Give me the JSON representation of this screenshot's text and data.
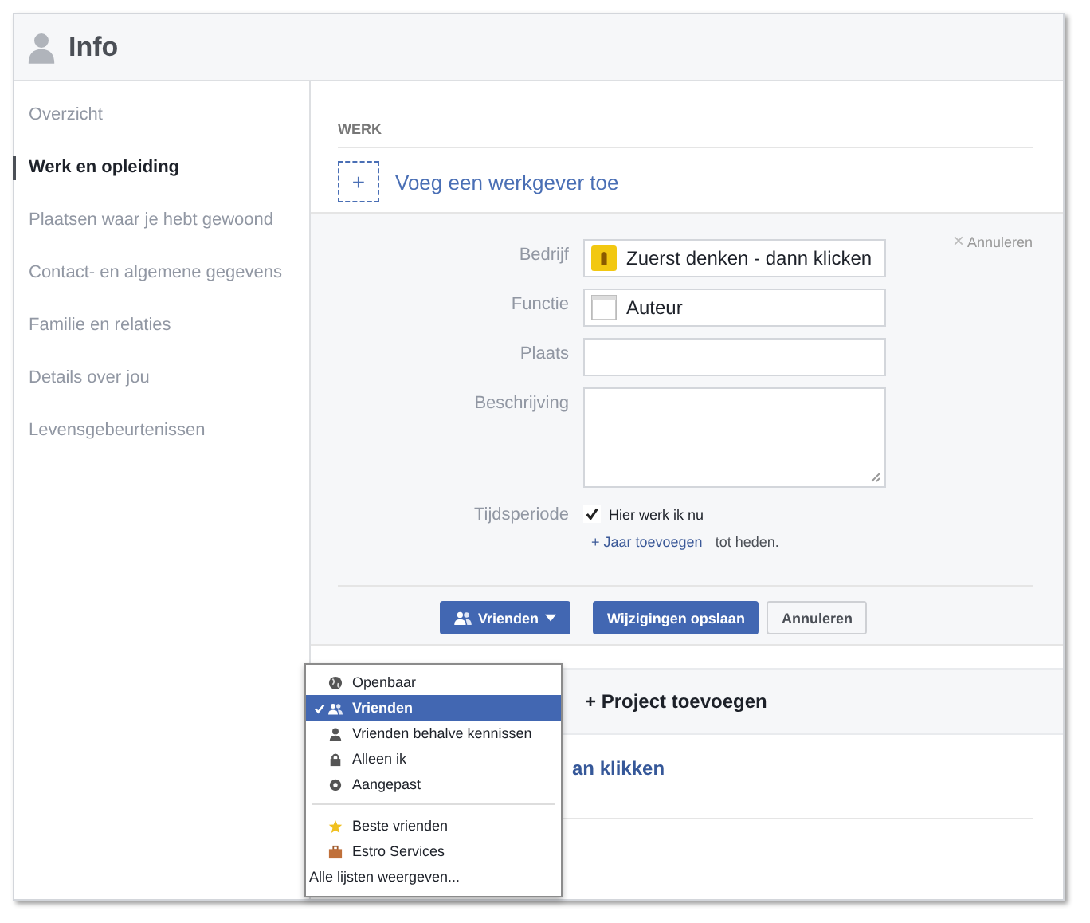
{
  "header": {
    "title": "Info"
  },
  "sidebar": {
    "items": [
      {
        "label": "Overzicht",
        "selected": false
      },
      {
        "label": "Werk en opleiding",
        "selected": true
      },
      {
        "label": "Plaatsen waar je hebt gewoond",
        "selected": false
      },
      {
        "label": "Contact- en algemene gegevens",
        "selected": false
      },
      {
        "label": "Familie en relaties",
        "selected": false
      },
      {
        "label": "Details over jou",
        "selected": false
      },
      {
        "label": "Levensgebeurtenissen",
        "selected": false
      }
    ]
  },
  "section": {
    "heading": "WERK",
    "add_link": "Voeg een werkgever toe",
    "add_symbol": "+"
  },
  "form": {
    "cancel_link": "Annuleren",
    "cancel_symbol": "×",
    "fields": [
      {
        "label": "Bedrijf",
        "kind": "company",
        "value": "Zuerst denken - dann klicken"
      },
      {
        "label": "Functie",
        "kind": "position",
        "value": "Auteur"
      },
      {
        "label": "Plaats",
        "kind": "text"
      },
      {
        "label": "Beschrijving",
        "kind": "textarea"
      }
    ],
    "period": {
      "label": "Tijdsperiode",
      "checkbox_label": "Hier werk ik nu",
      "checked": true,
      "year_link": "+ Jaar toevoegen",
      "suffix": "tot heden."
    },
    "audience_button": "Vrienden",
    "save_button": "Wijzigingen opslaan",
    "cancel_button": "Annuleren"
  },
  "project": {
    "label": "+ Project toevoegen"
  },
  "partial_text": "an klikken",
  "dropdown": {
    "items": [
      {
        "label": "Openbaar",
        "kind": "public",
        "selected": false
      },
      {
        "label": "Vrienden",
        "kind": "friends",
        "selected": true
      },
      {
        "label": "Vrienden behalve kennissen",
        "kind": "except",
        "selected": false
      },
      {
        "label": "Alleen ik",
        "kind": "only_me",
        "selected": false
      },
      {
        "label": "Aangepast",
        "kind": "custom",
        "selected": false
      },
      {
        "kind": "separator"
      },
      {
        "label": "Beste vrienden",
        "kind": "favorites",
        "selected": false
      },
      {
        "label": "Estro Services",
        "kind": "group",
        "selected": false
      },
      {
        "label": "Alle lijsten weergeven...",
        "kind": "more",
        "selected": false
      }
    ]
  }
}
